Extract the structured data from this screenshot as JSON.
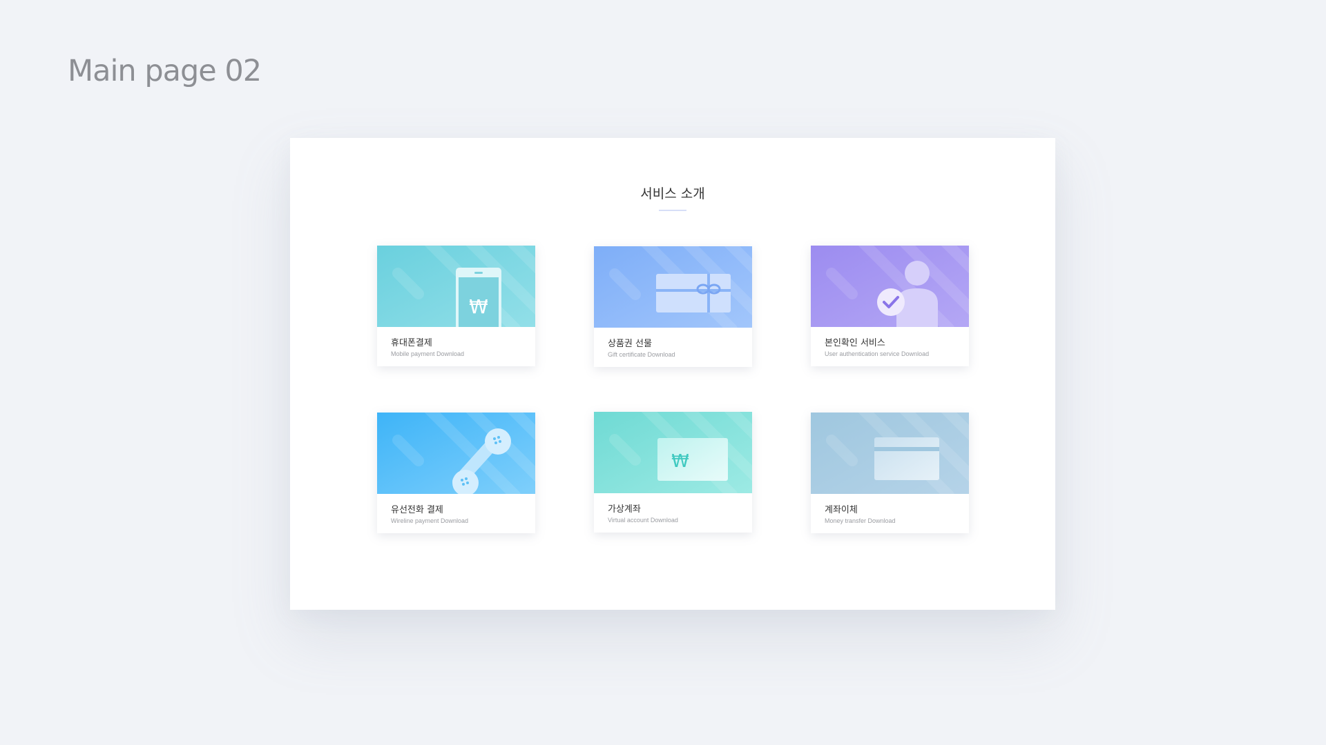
{
  "page_label": "Main page 02",
  "section": {
    "title": "서비스 소개"
  },
  "cards": [
    {
      "title": "휴대폰결제",
      "subtitle": "Mobile payment Download",
      "icon": "mobile-phone-won-icon",
      "gradient": [
        "#6ad0de",
        "#92dfe8"
      ]
    },
    {
      "title": "상품권 선물",
      "subtitle": "Gift certificate Download",
      "icon": "gift-card-icon",
      "gradient": [
        "#7eaef8",
        "#a2c6fb"
      ]
    },
    {
      "title": "본인확인 서비스",
      "subtitle": "User authentication service Download",
      "icon": "user-check-icon",
      "gradient": [
        "#9c8cf0",
        "#b4a7f5"
      ]
    },
    {
      "title": "유선전화 결제",
      "subtitle": "Wireline payment Download",
      "icon": "telephone-handset-icon",
      "gradient": [
        "#3eb4f8",
        "#7fcffb"
      ]
    },
    {
      "title": "가상계좌",
      "subtitle": "Virtual account Download",
      "icon": "won-card-icon",
      "gradient": [
        "#6fdad4",
        "#9deae4"
      ]
    },
    {
      "title": "계좌이체",
      "subtitle": "Money transfer Download",
      "icon": "bank-card-icon",
      "gradient": [
        "#9fc7df",
        "#b5d3e8"
      ]
    }
  ],
  "colors": {
    "background": "#f1f3f7",
    "panel": "#ffffff",
    "title_underline": "#d7def7",
    "won_symbol": "₩"
  }
}
